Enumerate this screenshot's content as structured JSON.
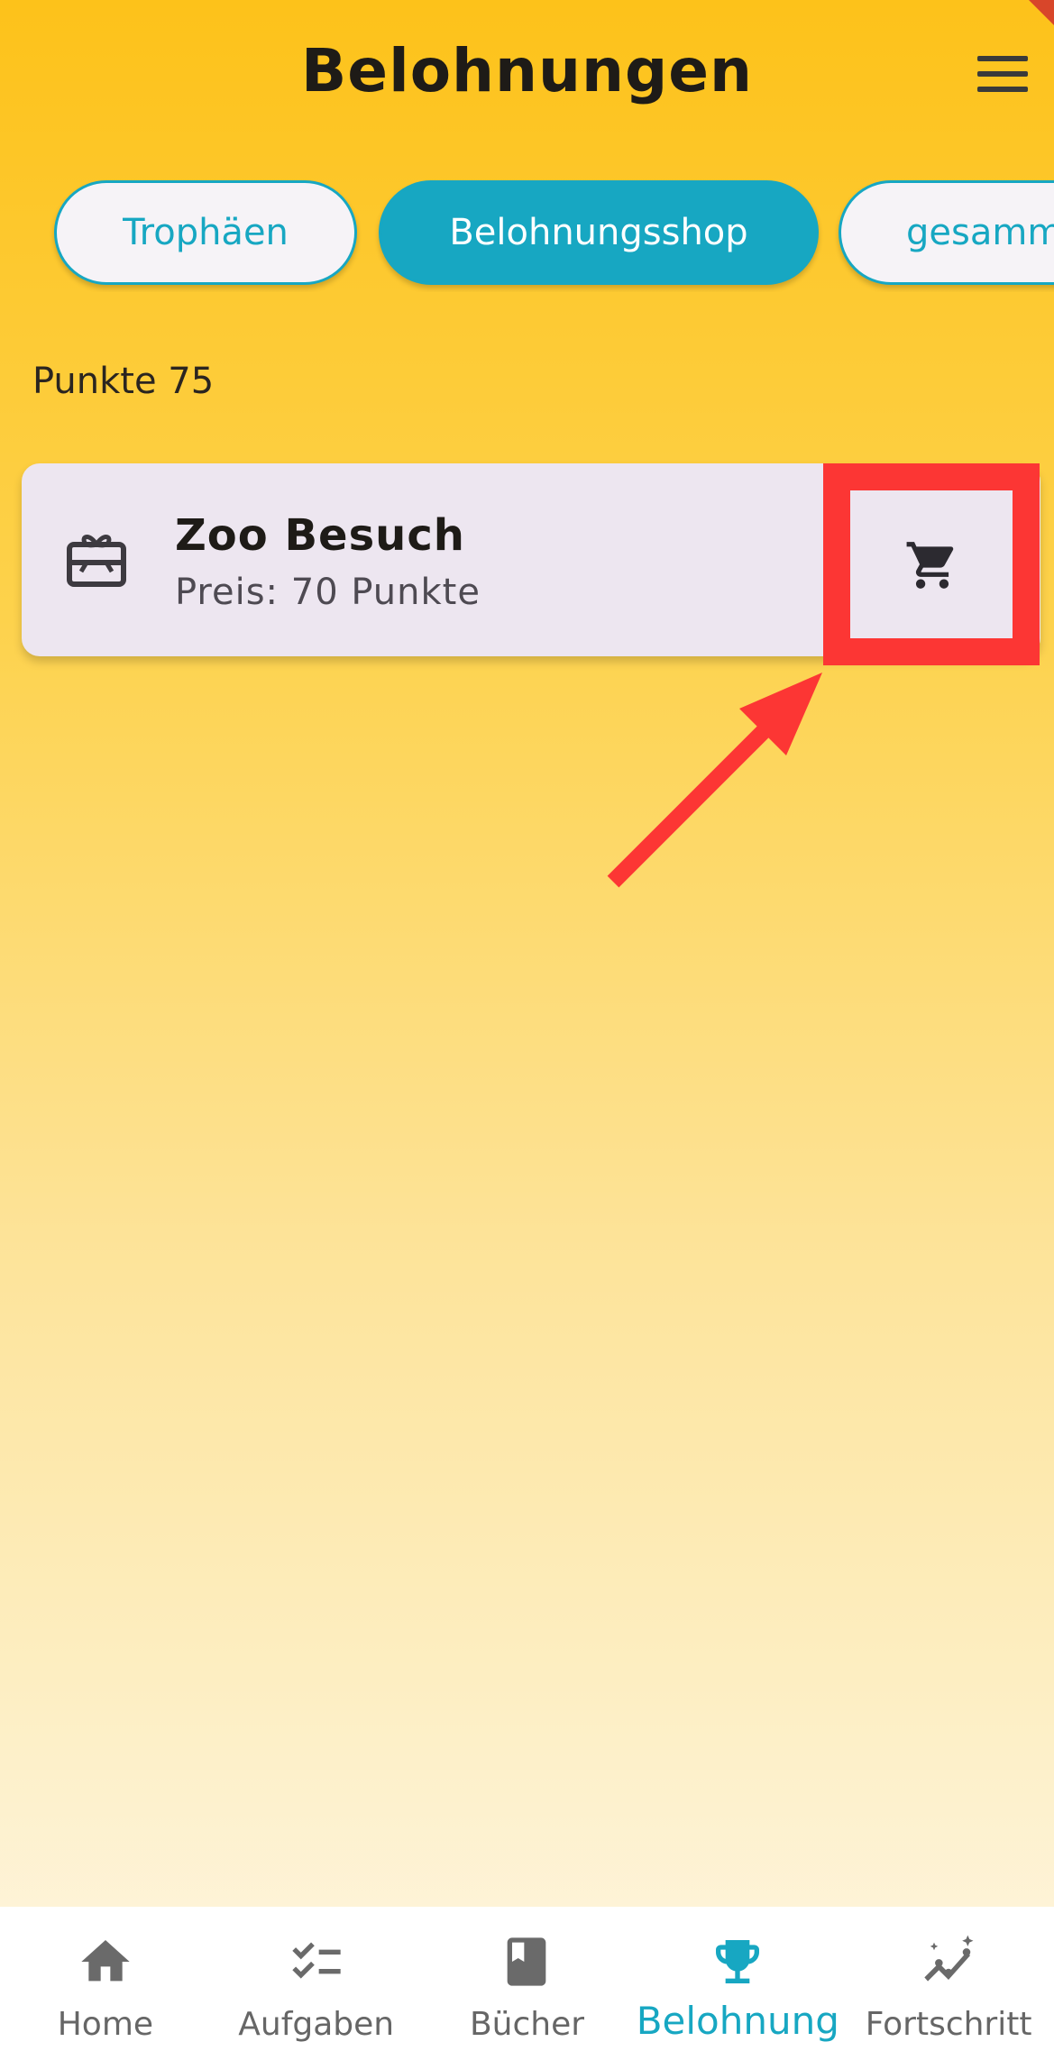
{
  "header": {
    "title": "Belohnungen",
    "menu_icon": "hamburger-menu-icon"
  },
  "tabs": [
    {
      "label": "Trophäen",
      "active": false
    },
    {
      "label": "Belohnungsshop",
      "active": true
    },
    {
      "label": "gesamm",
      "active": false
    }
  ],
  "points": {
    "label": "Punkte 75"
  },
  "reward": {
    "title": "Zoo Besuch",
    "price": "Preis: 70 Punkte",
    "icon": "gift-card-icon",
    "action_icon": "shopping-cart-icon"
  },
  "annotation": {
    "highlight_color": "#FC3634"
  },
  "bottom_nav": [
    {
      "label": "Home",
      "icon": "home-icon",
      "active": false
    },
    {
      "label": "Aufgaben",
      "icon": "checklist-icon",
      "active": false
    },
    {
      "label": "Bücher",
      "icon": "book-icon",
      "active": false
    },
    {
      "label": "Belohnung",
      "icon": "trophy-icon",
      "active": true
    },
    {
      "label": "Fortschritt",
      "icon": "progress-chart-icon",
      "active": false
    }
  ],
  "colors": {
    "accent": "#17A7C2",
    "background_top": "#FDC21A",
    "card": "#EDE6F0"
  }
}
